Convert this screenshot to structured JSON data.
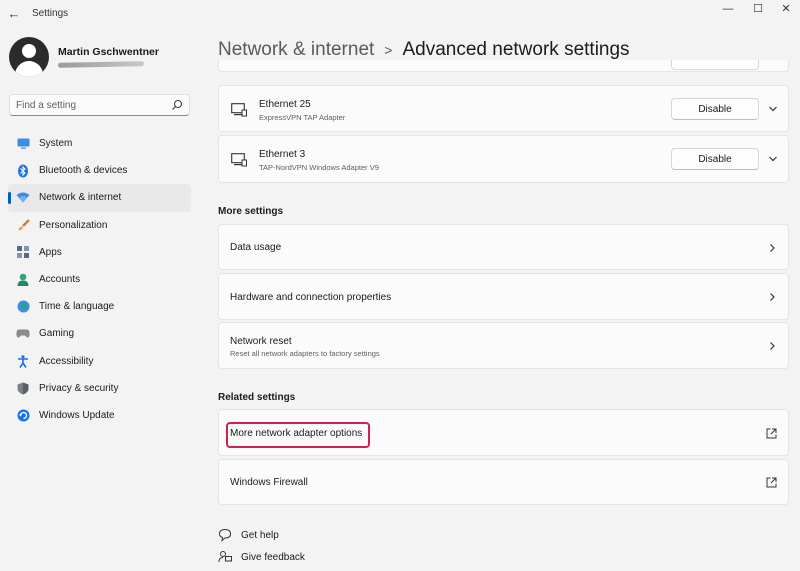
{
  "app": {
    "title": "Settings"
  },
  "profile": {
    "name": "Martin Gschwentner"
  },
  "search": {
    "placeholder": "Find a setting"
  },
  "sidebar": {
    "items": [
      {
        "label": "System",
        "icon": "system-icon",
        "active": false
      },
      {
        "label": "Bluetooth & devices",
        "icon": "bluetooth-icon",
        "active": false
      },
      {
        "label": "Network & internet",
        "icon": "wifi-icon",
        "active": true
      },
      {
        "label": "Personalization",
        "icon": "brush-icon",
        "active": false
      },
      {
        "label": "Apps",
        "icon": "apps-icon",
        "active": false
      },
      {
        "label": "Accounts",
        "icon": "accounts-icon",
        "active": false
      },
      {
        "label": "Time & language",
        "icon": "globe-icon",
        "active": false
      },
      {
        "label": "Gaming",
        "icon": "gamepad-icon",
        "active": false
      },
      {
        "label": "Accessibility",
        "icon": "accessibility-icon",
        "active": false
      },
      {
        "label": "Privacy & security",
        "icon": "shield-icon",
        "active": false
      },
      {
        "label": "Windows Update",
        "icon": "update-icon",
        "active": false
      }
    ]
  },
  "header": {
    "parent": "Network & internet",
    "separator": ">",
    "current": "Advanced network settings"
  },
  "adapters": [
    {
      "name": "Ethernet 25",
      "description": "ExpressVPN TAP Adapter",
      "button": "Disable"
    },
    {
      "name": "Ethernet 3",
      "description": "TAP-NordVPN Windows Adapter V9",
      "button": "Disable"
    }
  ],
  "more_settings": {
    "title": "More settings",
    "items": [
      {
        "title": "Data usage",
        "subtitle": ""
      },
      {
        "title": "Hardware and connection properties",
        "subtitle": ""
      },
      {
        "title": "Network reset",
        "subtitle": "Reset all network adapters to factory settings"
      }
    ]
  },
  "related_settings": {
    "title": "Related settings",
    "items": [
      {
        "title": "More network adapter options",
        "highlighted": true
      },
      {
        "title": "Windows Firewall",
        "highlighted": false
      }
    ]
  },
  "footer": {
    "help": "Get help",
    "feedback": "Give feedback"
  },
  "colors": {
    "accent": "#005fb8",
    "highlight": "#d0214e",
    "background": "#f3f3f3",
    "card": "#fbfbfb"
  }
}
